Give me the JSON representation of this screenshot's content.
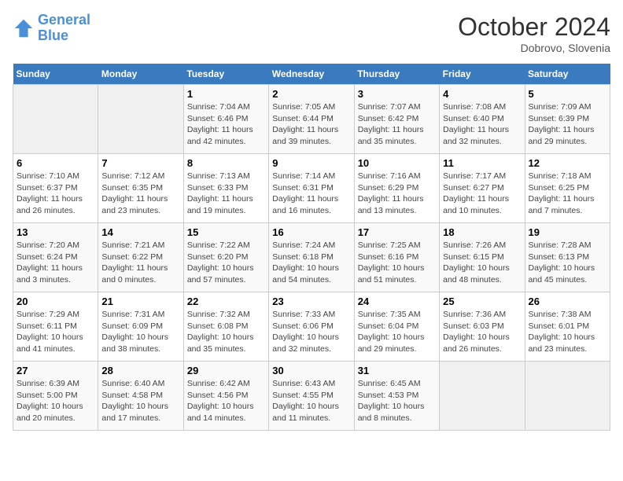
{
  "header": {
    "logo_line1": "General",
    "logo_line2": "Blue",
    "month": "October 2024",
    "location": "Dobrovo, Slovenia"
  },
  "weekdays": [
    "Sunday",
    "Monday",
    "Tuesday",
    "Wednesday",
    "Thursday",
    "Friday",
    "Saturday"
  ],
  "weeks": [
    [
      {
        "day": "",
        "info": ""
      },
      {
        "day": "",
        "info": ""
      },
      {
        "day": "1",
        "info": "Sunrise: 7:04 AM\nSunset: 6:46 PM\nDaylight: 11 hours and 42 minutes."
      },
      {
        "day": "2",
        "info": "Sunrise: 7:05 AM\nSunset: 6:44 PM\nDaylight: 11 hours and 39 minutes."
      },
      {
        "day": "3",
        "info": "Sunrise: 7:07 AM\nSunset: 6:42 PM\nDaylight: 11 hours and 35 minutes."
      },
      {
        "day": "4",
        "info": "Sunrise: 7:08 AM\nSunset: 6:40 PM\nDaylight: 11 hours and 32 minutes."
      },
      {
        "day": "5",
        "info": "Sunrise: 7:09 AM\nSunset: 6:39 PM\nDaylight: 11 hours and 29 minutes."
      }
    ],
    [
      {
        "day": "6",
        "info": "Sunrise: 7:10 AM\nSunset: 6:37 PM\nDaylight: 11 hours and 26 minutes."
      },
      {
        "day": "7",
        "info": "Sunrise: 7:12 AM\nSunset: 6:35 PM\nDaylight: 11 hours and 23 minutes."
      },
      {
        "day": "8",
        "info": "Sunrise: 7:13 AM\nSunset: 6:33 PM\nDaylight: 11 hours and 19 minutes."
      },
      {
        "day": "9",
        "info": "Sunrise: 7:14 AM\nSunset: 6:31 PM\nDaylight: 11 hours and 16 minutes."
      },
      {
        "day": "10",
        "info": "Sunrise: 7:16 AM\nSunset: 6:29 PM\nDaylight: 11 hours and 13 minutes."
      },
      {
        "day": "11",
        "info": "Sunrise: 7:17 AM\nSunset: 6:27 PM\nDaylight: 11 hours and 10 minutes."
      },
      {
        "day": "12",
        "info": "Sunrise: 7:18 AM\nSunset: 6:25 PM\nDaylight: 11 hours and 7 minutes."
      }
    ],
    [
      {
        "day": "13",
        "info": "Sunrise: 7:20 AM\nSunset: 6:24 PM\nDaylight: 11 hours and 3 minutes."
      },
      {
        "day": "14",
        "info": "Sunrise: 7:21 AM\nSunset: 6:22 PM\nDaylight: 11 hours and 0 minutes."
      },
      {
        "day": "15",
        "info": "Sunrise: 7:22 AM\nSunset: 6:20 PM\nDaylight: 10 hours and 57 minutes."
      },
      {
        "day": "16",
        "info": "Sunrise: 7:24 AM\nSunset: 6:18 PM\nDaylight: 10 hours and 54 minutes."
      },
      {
        "day": "17",
        "info": "Sunrise: 7:25 AM\nSunset: 6:16 PM\nDaylight: 10 hours and 51 minutes."
      },
      {
        "day": "18",
        "info": "Sunrise: 7:26 AM\nSunset: 6:15 PM\nDaylight: 10 hours and 48 minutes."
      },
      {
        "day": "19",
        "info": "Sunrise: 7:28 AM\nSunset: 6:13 PM\nDaylight: 10 hours and 45 minutes."
      }
    ],
    [
      {
        "day": "20",
        "info": "Sunrise: 7:29 AM\nSunset: 6:11 PM\nDaylight: 10 hours and 41 minutes."
      },
      {
        "day": "21",
        "info": "Sunrise: 7:31 AM\nSunset: 6:09 PM\nDaylight: 10 hours and 38 minutes."
      },
      {
        "day": "22",
        "info": "Sunrise: 7:32 AM\nSunset: 6:08 PM\nDaylight: 10 hours and 35 minutes."
      },
      {
        "day": "23",
        "info": "Sunrise: 7:33 AM\nSunset: 6:06 PM\nDaylight: 10 hours and 32 minutes."
      },
      {
        "day": "24",
        "info": "Sunrise: 7:35 AM\nSunset: 6:04 PM\nDaylight: 10 hours and 29 minutes."
      },
      {
        "day": "25",
        "info": "Sunrise: 7:36 AM\nSunset: 6:03 PM\nDaylight: 10 hours and 26 minutes."
      },
      {
        "day": "26",
        "info": "Sunrise: 7:38 AM\nSunset: 6:01 PM\nDaylight: 10 hours and 23 minutes."
      }
    ],
    [
      {
        "day": "27",
        "info": "Sunrise: 6:39 AM\nSunset: 5:00 PM\nDaylight: 10 hours and 20 minutes."
      },
      {
        "day": "28",
        "info": "Sunrise: 6:40 AM\nSunset: 4:58 PM\nDaylight: 10 hours and 17 minutes."
      },
      {
        "day": "29",
        "info": "Sunrise: 6:42 AM\nSunset: 4:56 PM\nDaylight: 10 hours and 14 minutes."
      },
      {
        "day": "30",
        "info": "Sunrise: 6:43 AM\nSunset: 4:55 PM\nDaylight: 10 hours and 11 minutes."
      },
      {
        "day": "31",
        "info": "Sunrise: 6:45 AM\nSunset: 4:53 PM\nDaylight: 10 hours and 8 minutes."
      },
      {
        "day": "",
        "info": ""
      },
      {
        "day": "",
        "info": ""
      }
    ]
  ]
}
